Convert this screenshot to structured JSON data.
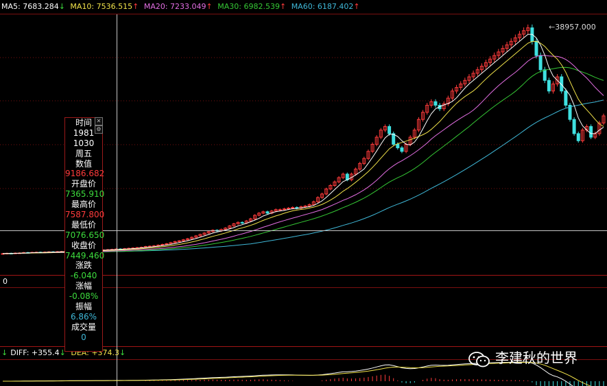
{
  "ma_bar": {
    "ma5": {
      "label": "MA5: 7683.284",
      "arrow": "↓",
      "color": "#ffffff"
    },
    "ma10": {
      "label": "MA10: 7536.515",
      "arrow": "↑",
      "color": "#f2e34a"
    },
    "ma20": {
      "label": "MA20: 7233.049",
      "arrow": "↑",
      "color": "#e36ee3"
    },
    "ma30": {
      "label": "MA30: 6982.539",
      "arrow": "↑",
      "color": "#35c835"
    },
    "ma60": {
      "label": "MA60: 6187.402",
      "arrow": "↑",
      "color": "#3fb8d8"
    }
  },
  "macd_bar": {
    "diff": {
      "prefix": "↓",
      "label": "DIFF: +355.4",
      "arrow": "↓",
      "color": "#ffffff"
    },
    "dea": {
      "label": "DEA: +374.3",
      "arrow": "↓",
      "color": "#f2e34a"
    }
  },
  "zero_label": "0",
  "peak_label": "38957.000",
  "tooltip": {
    "rows": [
      {
        "text": "时间",
        "color": "#ffffff"
      },
      {
        "text": "1981",
        "color": "#ffffff"
      },
      {
        "text": "1030",
        "color": "#ffffff"
      },
      {
        "text": "周五",
        "color": "#ffffff"
      },
      {
        "text": "数值",
        "color": "#ffffff"
      },
      {
        "text": "9186.682",
        "color": "#ff3b3b"
      },
      {
        "text": "开盘价",
        "color": "#ffffff"
      },
      {
        "text": "7365.910",
        "color": "#3ddc3d"
      },
      {
        "text": "最高价",
        "color": "#ffffff"
      },
      {
        "text": "7587.800",
        "color": "#ff3b3b"
      },
      {
        "text": "最低价",
        "color": "#ffffff"
      },
      {
        "text": "7076.650",
        "color": "#3ddc3d"
      },
      {
        "text": "收盘价",
        "color": "#ffffff"
      },
      {
        "text": "7449.460",
        "color": "#3ddc3d"
      },
      {
        "text": "涨跌",
        "color": "#ffffff"
      },
      {
        "text": "-6.040",
        "color": "#3ddc3d"
      },
      {
        "text": "涨幅",
        "color": "#ffffff"
      },
      {
        "text": "-0.08%",
        "color": "#3ddc3d"
      },
      {
        "text": "振幅",
        "color": "#ffffff"
      },
      {
        "text": "6.86%",
        "color": "#3fb8d8"
      },
      {
        "text": "成交量",
        "color": "#ffffff"
      },
      {
        "text": "0",
        "color": "#3fb8d8"
      }
    ],
    "close_icon": "close-icon",
    "gear_icon": "gear-icon"
  },
  "watermark": {
    "text": "李建秋的世界",
    "icon": "wechat-icon"
  },
  "colors": {
    "up": "#ff3b3b",
    "down": "#3fe0e0",
    "grid_red": "#7a0f0f",
    "crosshair": "#c8c8c8",
    "ma5": "#ffffff",
    "ma10": "#f2e34a",
    "ma20": "#e36ee3",
    "ma30": "#35c835",
    "ma60": "#3fb8d8"
  },
  "chart_data": {
    "type": "candlestick",
    "title": "",
    "series_note": "weekly candles, Nikkei-style index 1981-1990",
    "y_peak": 38957.0,
    "crosshair_date": "1981-10-30",
    "crosshair_value": 9186.682,
    "closes": [
      7100,
      7150,
      7120,
      7180,
      7200,
      7250,
      7230,
      7280,
      7300,
      7260,
      7320,
      7350,
      7330,
      7380,
      7400,
      7420,
      7449,
      7460,
      7500,
      7480,
      7520,
      7560,
      7600,
      7580,
      7620,
      7660,
      7700,
      7750,
      7720,
      7800,
      7850,
      7900,
      7950,
      8000,
      8100,
      8150,
      8200,
      8300,
      8400,
      8500,
      8650,
      8800,
      8900,
      9050,
      9200,
      9400,
      9600,
      9800,
      10000,
      10200,
      10400,
      10300,
      10500,
      10700,
      11000,
      11300,
      11500,
      11400,
      11700,
      12000,
      12500,
      12800,
      13000,
      12800,
      13100,
      13300,
      13300,
      13400,
      13500,
      13600,
      13500,
      13700,
      13800,
      14000,
      14400,
      15000,
      15500,
      16200,
      16700,
      17200,
      17800,
      18300,
      17500,
      18300,
      19000,
      19800,
      20500,
      21500,
      22500,
      23500,
      24500,
      25000,
      24000,
      22500,
      22000,
      21500,
      22500,
      23500,
      24500,
      26000,
      27000,
      28000,
      28500,
      28000,
      27500,
      28200,
      29000,
      30000,
      30500,
      31000,
      31500,
      32000,
      32500,
      33000,
      33500,
      34000,
      34500,
      35000,
      35500,
      36000,
      36500,
      37000,
      37500,
      38000,
      38500,
      38900,
      37000,
      35000,
      33000,
      31500,
      30000,
      31000,
      32000,
      30000,
      28000,
      26000,
      24000,
      23000,
      24500,
      25000,
      23500,
      24000,
      25500,
      26500
    ]
  }
}
